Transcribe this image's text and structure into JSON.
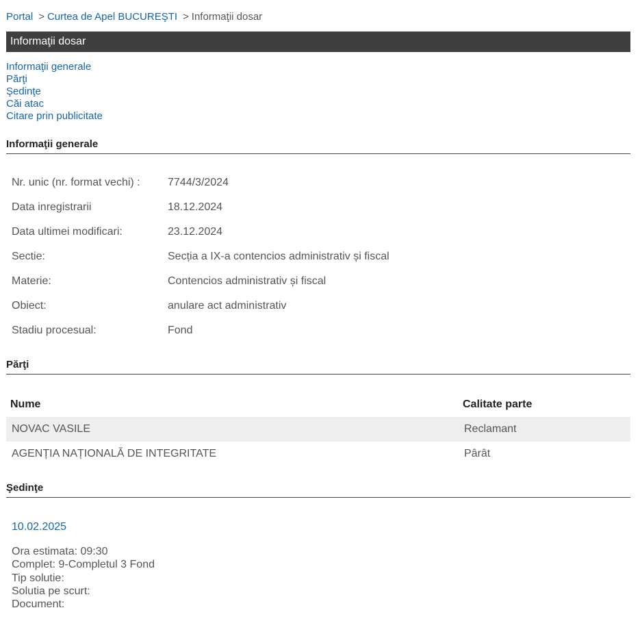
{
  "breadcrumb": {
    "portal": "Portal",
    "sep1": ">",
    "court": "Curtea de Apel BUCUREŞTI",
    "sep2": ">",
    "current": "Informaţii dosar"
  },
  "title": "Informaţii dosar",
  "toc": [
    "Informaţii generale",
    "Părţi",
    "Şedinţe",
    "Căi atac",
    "Citare prin publicitate"
  ],
  "general": {
    "heading": "Informaţii generale",
    "rows": [
      {
        "label": "Nr. unic (nr. format vechi) :",
        "value": "7744/3/2024"
      },
      {
        "label": "Data inregistrarii",
        "value": "18.12.2024"
      },
      {
        "label": "Data ultimei modificari:",
        "value": "23.12.2024"
      },
      {
        "label": "Sectie:",
        "value": "Secția a IX-a contencios administrativ și fiscal"
      },
      {
        "label": "Materie:",
        "value": "Contencios administrativ și fiscal"
      },
      {
        "label": "Obiect:",
        "value": "anulare act administrativ"
      },
      {
        "label": "Stadiu procesual:",
        "value": "Fond"
      }
    ]
  },
  "parti": {
    "heading": "Părţi",
    "col_name": "Nume",
    "col_role": "Calitate parte",
    "rows": [
      {
        "name": "NOVAC VASILE",
        "role": "Reclamant"
      },
      {
        "name": "AGENȚIA NAȚIONALĂ DE INTEGRITATE",
        "role": "Pârât"
      }
    ]
  },
  "sedinte": {
    "heading": "Şedinţe",
    "date": "10.02.2025",
    "lines": [
      "Ora estimata: 09:30",
      "Complet: 9-Completul 3 Fond",
      "Tip solutie:",
      "Solutia pe scurt:",
      "Document:"
    ]
  }
}
